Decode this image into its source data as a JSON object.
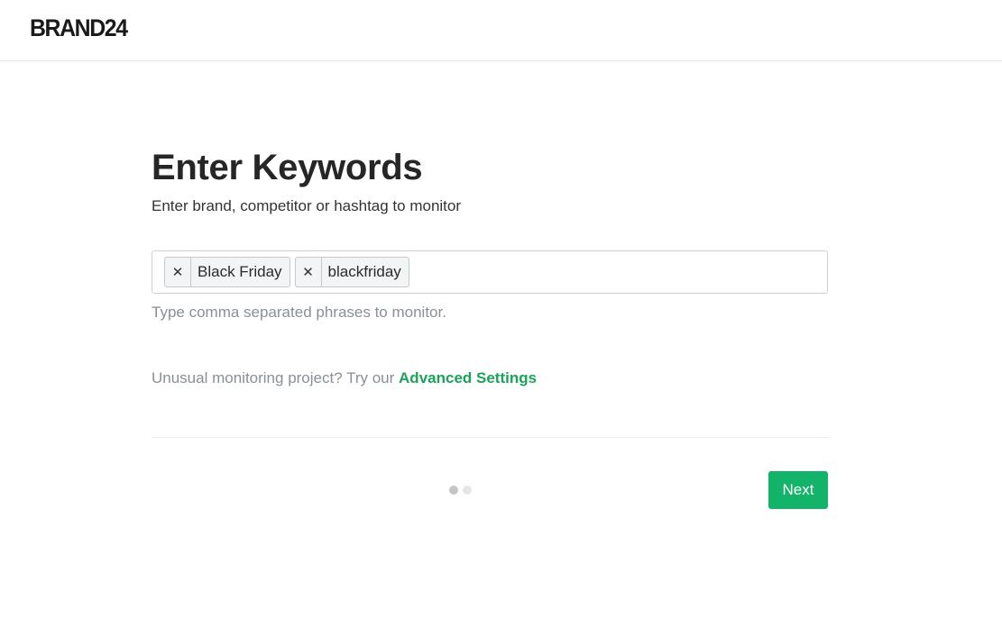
{
  "header": {
    "logo_text": "BRAND24"
  },
  "main": {
    "title": "Enter Keywords",
    "subtitle": "Enter brand, competitor or hashtag to monitor",
    "keywords": [
      {
        "label": "Black Friday",
        "remove_icon": "close-icon"
      },
      {
        "label": "blackfriday",
        "remove_icon": "close-icon"
      }
    ],
    "keyword_input_value": "",
    "hint": "Type comma separated phrases to monitor.",
    "advanced_prefix": "Unusual monitoring project? Try our ",
    "advanced_link": "Advanced Settings",
    "next_label": "Next",
    "step": {
      "current": 1,
      "total": 2
    }
  },
  "colors": {
    "accent": "#13b36a",
    "link": "#1aa35a",
    "hint_text": "#8a8f96"
  }
}
